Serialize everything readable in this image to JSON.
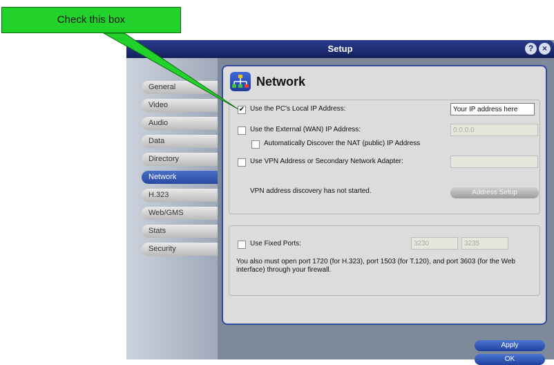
{
  "window": {
    "title": "Setup",
    "help_label": "?",
    "close_label": "×"
  },
  "sidebar": {
    "items": [
      {
        "label": "General"
      },
      {
        "label": "Video"
      },
      {
        "label": "Audio"
      },
      {
        "label": "Data"
      },
      {
        "label": "Directory"
      },
      {
        "label": "Network"
      },
      {
        "label": "H.323"
      },
      {
        "label": "Web/GMS"
      },
      {
        "label": "Stats"
      },
      {
        "label": "Security"
      }
    ],
    "active": "Network"
  },
  "panel": {
    "title": "Network",
    "local_ip": {
      "label": "Use the PC's Local IP Address:",
      "checked": true,
      "value": "Your IP address here"
    },
    "wan_ip": {
      "label": "Use the External (WAN) IP Address:",
      "checked": false,
      "value": "0.0.0.0"
    },
    "nat": {
      "label": "Automatically Discover the NAT (public) IP Address",
      "checked": false
    },
    "vpn": {
      "label": "Use VPN Address or Secondary Network Adapter:",
      "checked": false,
      "value": ""
    },
    "vpn_status": "VPN address discovery has not started.",
    "address_setup_button": "Address Setup",
    "fixed_ports": {
      "label": "Use Fixed Ports:",
      "checked": false,
      "port1": "3230",
      "port2": "3235"
    },
    "ports_note": "You also must open port 1720 (for H.323), port 1503 (for T.120), and port 3603 (for the Web interface) through your firewall."
  },
  "buttons": {
    "apply": "Apply",
    "ok": "OK"
  },
  "callout": {
    "text": "Check this box",
    "color": "#22d22a"
  }
}
